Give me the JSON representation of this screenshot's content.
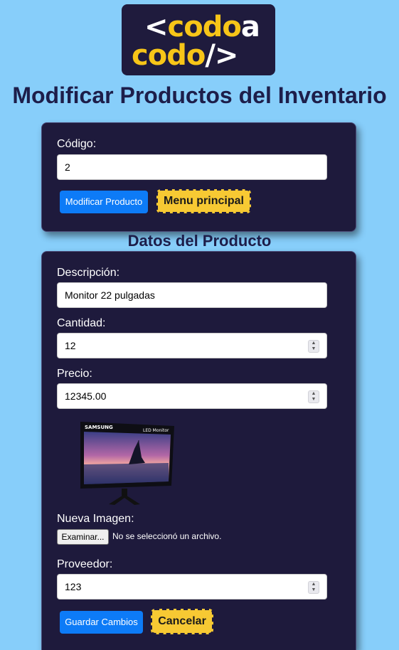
{
  "logo": {
    "text_lt": "<",
    "text_codo": "codo",
    "text_a": "a",
    "text_codo2": "codo",
    "text_slash": "/>"
  },
  "page_title": "Modificar Productos del Inventario",
  "search": {
    "code_label": "Código:",
    "code_value": "2",
    "modify_button": "Modificar Producto",
    "menu_button": "Menu principal"
  },
  "section_title": "Datos del Producto",
  "form": {
    "description_label": "Descripción:",
    "description_value": "Monitor 22 pulgadas",
    "quantity_label": "Cantidad:",
    "quantity_value": "12",
    "price_label": "Precio:",
    "price_value": "12345.00",
    "image": {
      "brand": "SAMSUNG",
      "caption": "LED Monitor"
    },
    "new_image_label": "Nueva Imagen:",
    "file_button": "Examinar...",
    "file_status": "No se seleccionó un archivo.",
    "supplier_label": "Proveedor:",
    "supplier_value": "123",
    "save_button": "Guardar Cambios",
    "cancel_button": "Cancelar"
  }
}
